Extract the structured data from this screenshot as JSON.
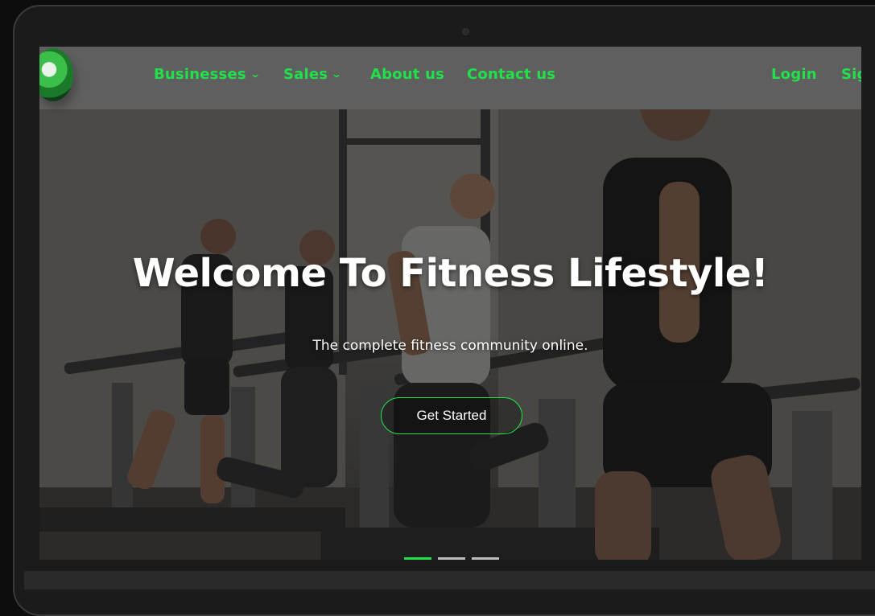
{
  "navbar": {
    "items": [
      {
        "label": "Businesses",
        "has_dropdown": true
      },
      {
        "label": "Sales",
        "has_dropdown": true
      },
      {
        "label": "About us",
        "has_dropdown": false
      },
      {
        "label": "Contact us",
        "has_dropdown": false
      }
    ],
    "login": "Login",
    "signup": "Sig",
    "dropdown_icon": "chevron-down-icon"
  },
  "hero": {
    "title": "Welcome To Fitness Lifestyle!",
    "subtitle": "The complete fitness community online.",
    "cta": "Get Started",
    "background": "gym-treadmill-runners-photo"
  },
  "carousel": {
    "slides": 3,
    "active_index": 0
  },
  "colors": {
    "accent": "#22e049",
    "navbar_bg": "#5f5f5f",
    "text": "#ffffff"
  }
}
